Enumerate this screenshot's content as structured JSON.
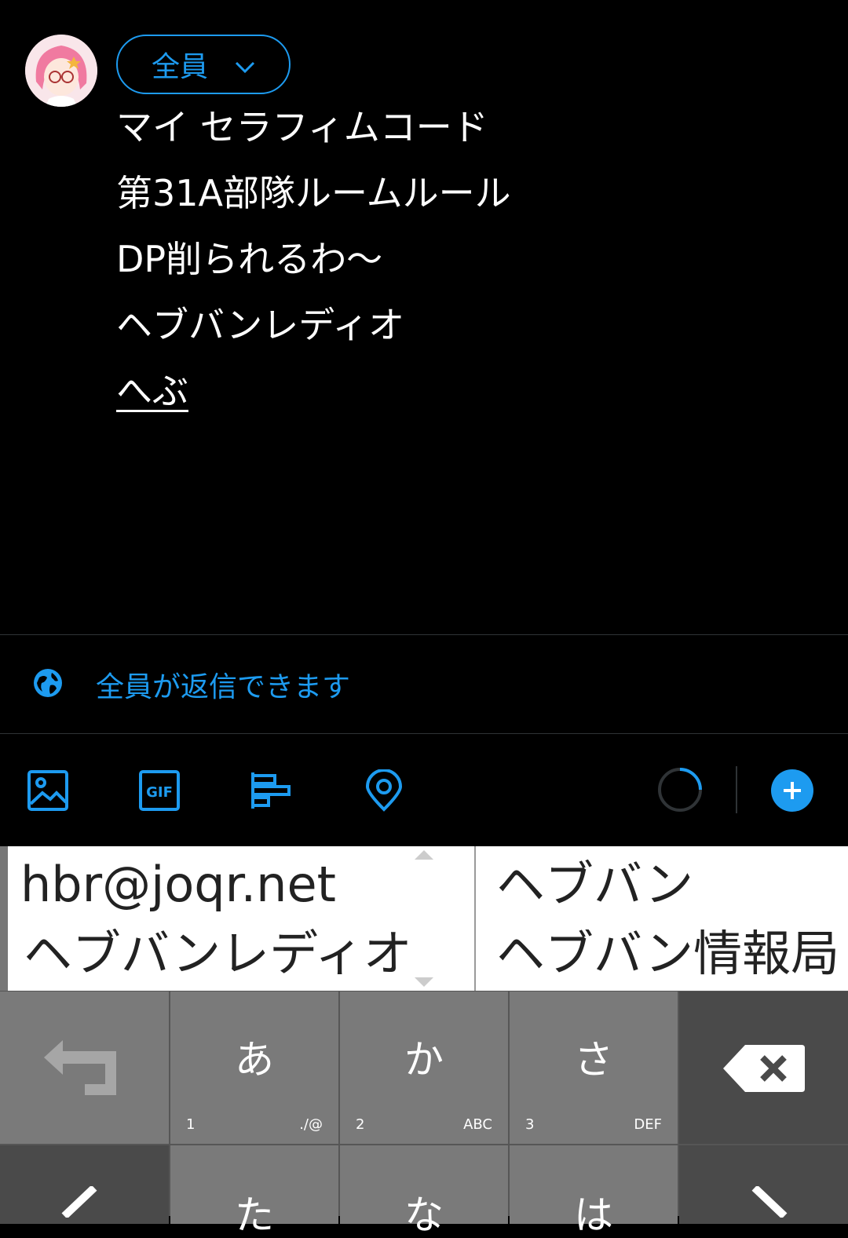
{
  "header": {
    "audience_label": "全員"
  },
  "compose": {
    "lines": [
      "マイ セラフィムコード",
      "第31A部隊ルームルール",
      "DP削られるわ〜",
      "ヘブバンレディオ",
      "へぶ"
    ]
  },
  "reply_setting": {
    "label": "全員が返信できます"
  },
  "toolbar": {
    "icons": [
      "image-icon",
      "gif-icon",
      "poll-icon",
      "location-icon",
      "char-progress",
      "add-thread-icon"
    ],
    "gif_label": "GIF"
  },
  "suggestions": {
    "left": [
      "hbr@joqr.net",
      "ヘブバンレディオ"
    ],
    "right": [
      "ヘブバン",
      "ヘブバン情報局"
    ]
  },
  "keyboard": {
    "row1": [
      {
        "main": "",
        "sub_left": "",
        "sub_right": ""
      },
      {
        "main": "あ",
        "sub_left": "1",
        "sub_right": "./@"
      },
      {
        "main": "か",
        "sub_left": "2",
        "sub_right": "ABC"
      },
      {
        "main": "さ",
        "sub_left": "3",
        "sub_right": "DEF"
      }
    ],
    "row2": [
      {
        "main": "た"
      },
      {
        "main": "な"
      },
      {
        "main": "は"
      }
    ]
  }
}
